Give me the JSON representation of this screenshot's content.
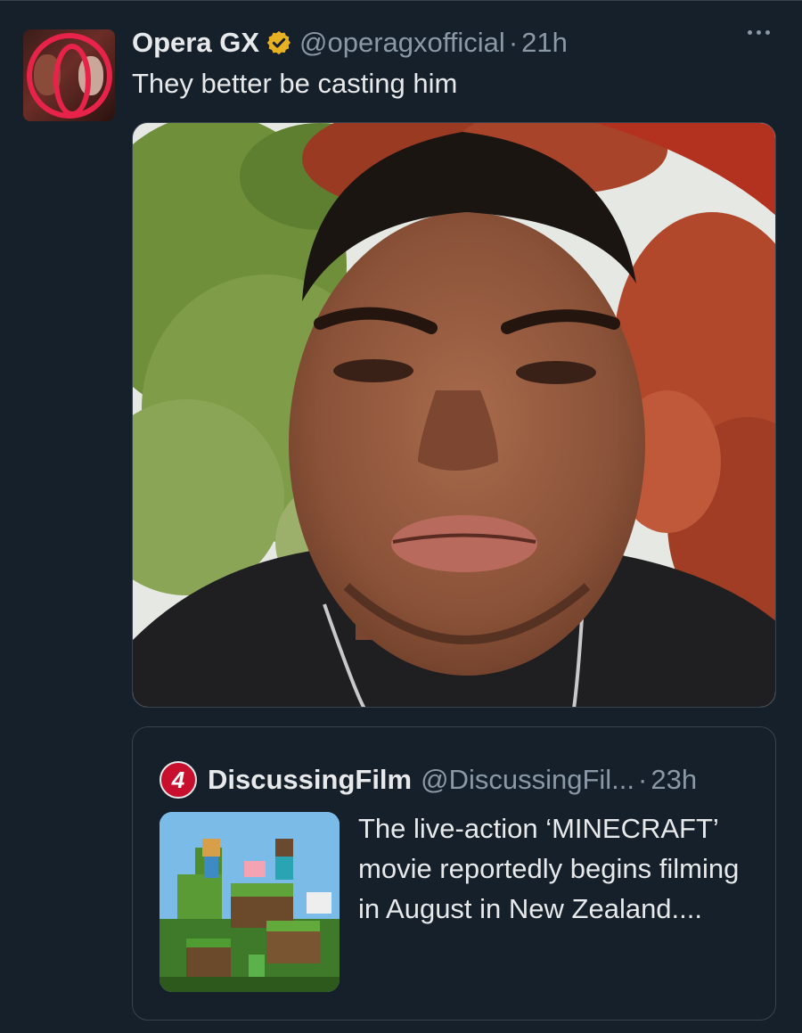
{
  "tweet": {
    "display_name": "Opera GX",
    "handle": "@operagxofficial",
    "separator": "·",
    "time": "21h",
    "text": "They better be casting him",
    "avatar_icon": "opera-gx-logo-icon",
    "verified_icon": "verified-badge-icon",
    "more_icon": "more-options-icon"
  },
  "media": {
    "description_icon": "selfie-photo"
  },
  "quote": {
    "display_name": "DiscussingFilm",
    "avatar_letter": "4",
    "handle": "@DiscussingFil...",
    "separator": "·",
    "time": "23h",
    "text": "The live-action ‘MINECRAFT’ movie reportedly begins filming in August in New Zealand...."
  },
  "colors": {
    "background": "#15202b",
    "text_primary": "#e7e9ea",
    "text_secondary": "#8b98a5",
    "border": "#38444d",
    "verified": "#e8b124",
    "brand_red": "#e8234a"
  }
}
